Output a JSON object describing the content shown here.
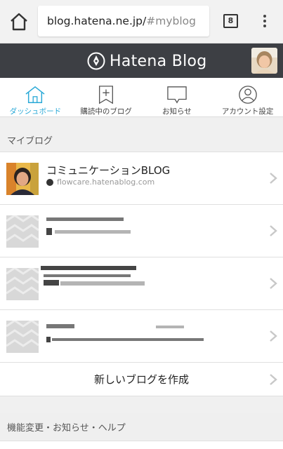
{
  "browser": {
    "url_host": "blog.hatena.ne.jp/",
    "url_hash": "#myblog",
    "tab_count": "8"
  },
  "header": {
    "logo_text": "Hatena Blog"
  },
  "nav": {
    "items": [
      {
        "label": "ダッシュボード",
        "icon": "house-icon",
        "active": true
      },
      {
        "label": "購読中のブログ",
        "icon": "bookmark-plus-icon",
        "active": false
      },
      {
        "label": "お知らせ",
        "icon": "speech-bubble-icon",
        "active": false
      },
      {
        "label": "アカウント設定",
        "icon": "person-icon",
        "active": false
      }
    ],
    "active_color": "#2aa9d7"
  },
  "my_blogs": {
    "section_title": "マイブログ",
    "blogs": [
      {
        "title": "コミュニケーションBLOG",
        "url": "flowcare.hatenablog.com"
      }
    ],
    "create_label": "新しいブログを作成"
  },
  "footer": {
    "section_title": "機能変更・お知らせ・ヘルプ"
  },
  "colors": {
    "header_bg": "#3d3f44",
    "accent": "#2aa9d7"
  }
}
